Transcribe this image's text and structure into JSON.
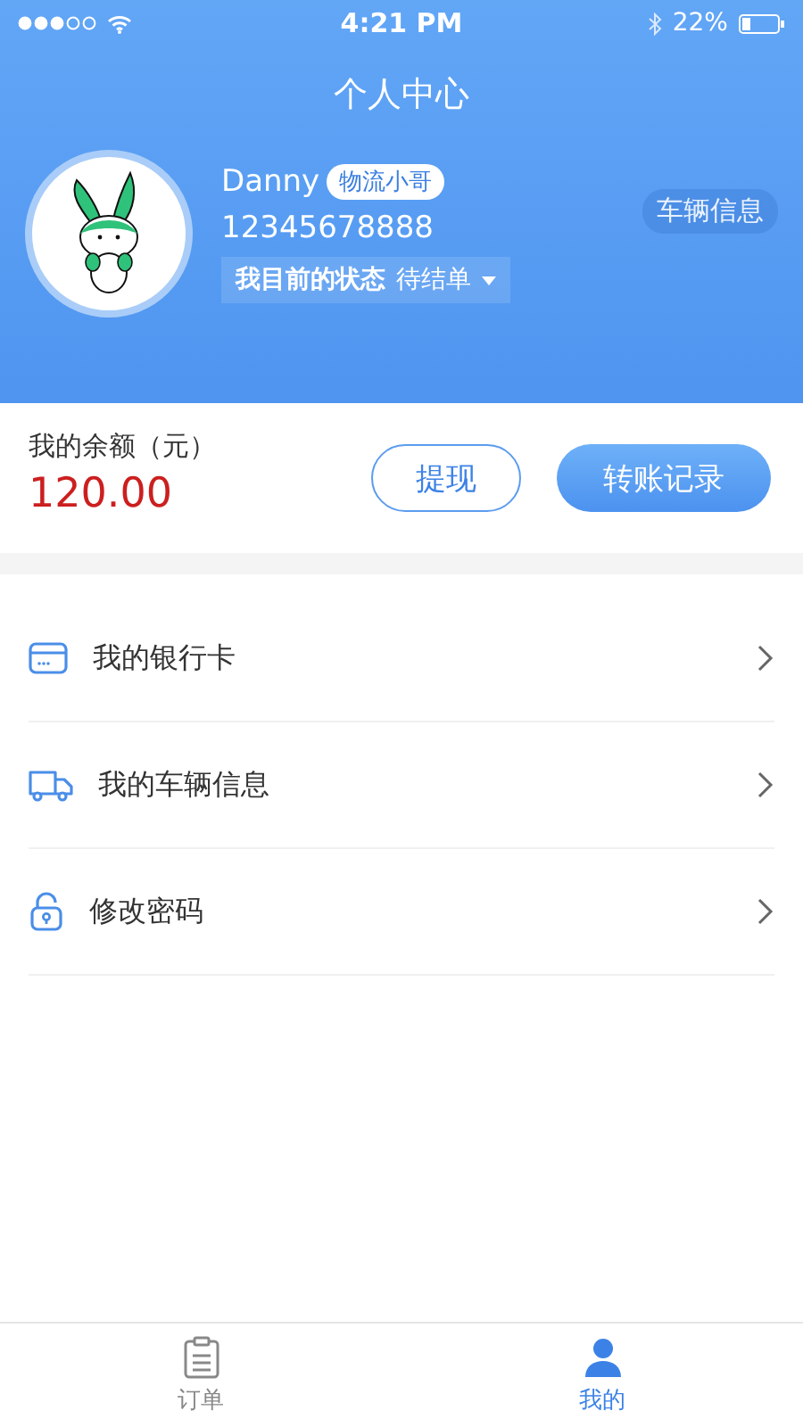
{
  "status_bar": {
    "time": "4:21 PM",
    "battery": "22%"
  },
  "header": {
    "title": "个人中心",
    "name": "Danny",
    "role_badge": "物流小哥",
    "phone": "12345678888",
    "status_label": "我目前的状态",
    "status_value": "待结单",
    "vehicle_button": "车辆信息"
  },
  "balance": {
    "label": "我的余额（元）",
    "amount": "120.00",
    "withdraw_button": "提现",
    "records_button": "转账记录"
  },
  "menu": [
    {
      "kind": "card",
      "label": "我的银行卡"
    },
    {
      "kind": "truck",
      "label": "我的车辆信息"
    },
    {
      "kind": "lock",
      "label": "修改密码"
    }
  ],
  "tab_bar": [
    {
      "kind": "orders",
      "label": "订单",
      "selected": false
    },
    {
      "kind": "me",
      "label": "我的",
      "selected": true
    }
  ]
}
